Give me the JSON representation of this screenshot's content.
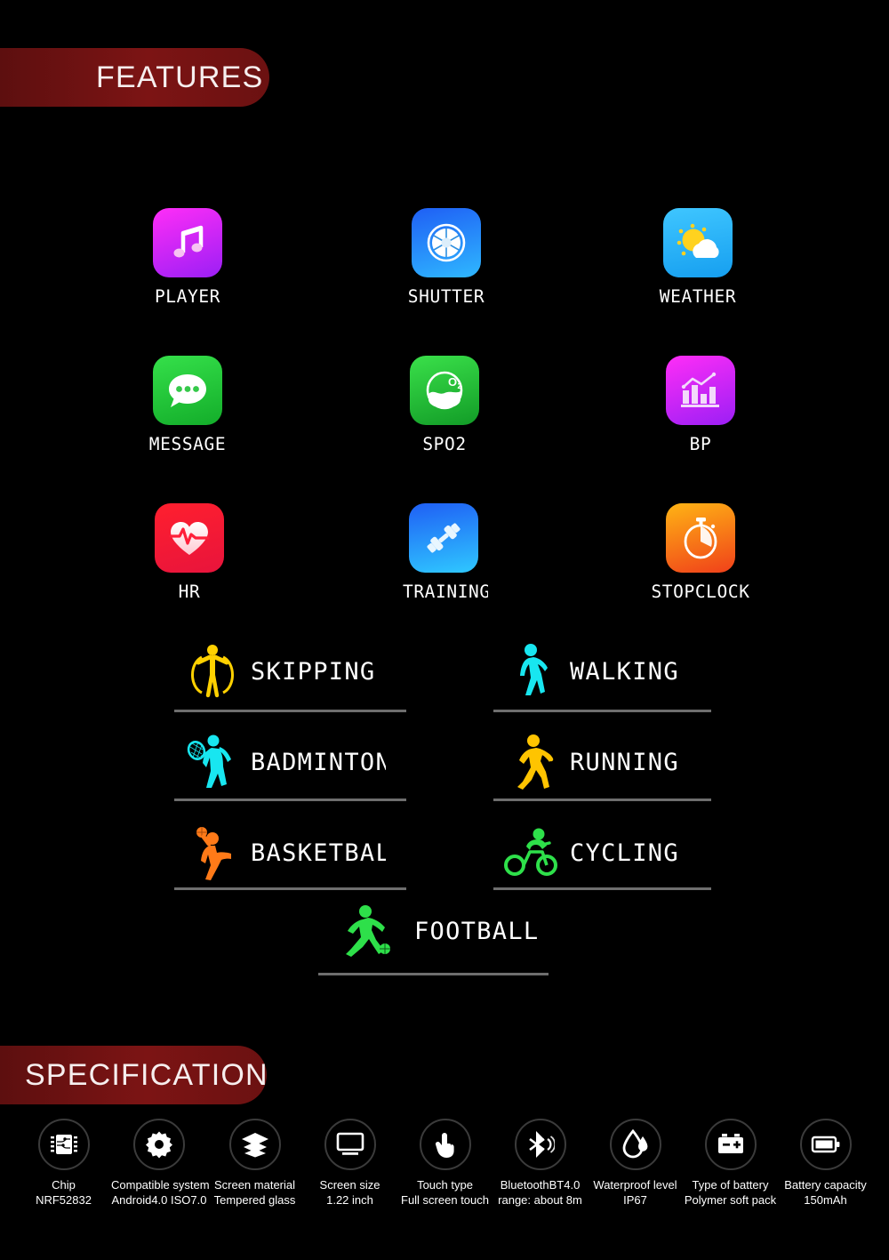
{
  "sections": {
    "features_banner": "FEATURES",
    "specification_banner": "SPECIFICATION"
  },
  "apps": [
    {
      "label": "PLAYER",
      "icon": "music-note-icon",
      "c1": "#ff2df7",
      "c2": "#9b1ff5"
    },
    {
      "label": "SHUTTER",
      "icon": "camera-shutter-icon",
      "c1": "#1f5ff5",
      "c2": "#2fb8ff"
    },
    {
      "label": "WEATHER",
      "icon": "sun-cloud-icon",
      "c1": "#2fb8ff",
      "c2": "#1f9ef5"
    },
    {
      "label": "MESSAGE",
      "icon": "speech-bubble-icon",
      "c1": "#2fe04a",
      "c2": "#13b52c"
    },
    {
      "label": "SPO2",
      "icon": "oxygen-drop-icon",
      "c1": "#35e04a",
      "c2": "#17a92a"
    },
    {
      "label": "BP",
      "icon": "bar-chart-icon",
      "c1": "#ff2df7",
      "c2": "#9b1ff5"
    },
    {
      "label": "HR",
      "icon": "heart-pulse-icon",
      "c1": "#ff1f2e",
      "c2": "#e8143c"
    },
    {
      "label": "TRAINING",
      "icon": "dumbbell-icon",
      "c1": "#1f5ff5",
      "c2": "#2fc8ff"
    },
    {
      "label": "STOPCLOCK",
      "icon": "stopwatch-icon",
      "c1": "#ffb414",
      "c2": "#f0401a"
    }
  ],
  "sports": [
    {
      "label": "SKIPPING",
      "icon": "skipping-rope-icon",
      "color": "#ffd100"
    },
    {
      "label": "WALKING",
      "icon": "walking-person-icon",
      "color": "#18e6f0"
    },
    {
      "label": "BADMINTON",
      "icon": "badminton-icon",
      "color": "#18e6f0"
    },
    {
      "label": "RUNNING",
      "icon": "running-person-icon",
      "color": "#ffc400"
    },
    {
      "label": "BASKETBALL",
      "icon": "basketball-icon",
      "color": "#ff7a18"
    },
    {
      "label": "CYCLING",
      "icon": "cycling-icon",
      "color": "#2ee04a"
    },
    {
      "label": "FOOTBALL",
      "icon": "football-icon",
      "color": "#2ee04a"
    }
  ],
  "specs": [
    {
      "title": "Chip",
      "value": "NRF52832",
      "icon": "chip-icon"
    },
    {
      "title": "Compatible system",
      "value": "Android4.0 ISO7.0",
      "icon": "gear-icon"
    },
    {
      "title": "Screen material",
      "value": "Tempered glass",
      "icon": "layers-icon"
    },
    {
      "title": "Screen size",
      "value": "1.22 inch",
      "icon": "monitor-icon"
    },
    {
      "title": "Touch type",
      "value": "Full screen touch",
      "icon": "hand-touch-icon"
    },
    {
      "title": "BluetoothBT4.0",
      "value": "range: about 8m",
      "icon": "bluetooth-icon"
    },
    {
      "title": "Waterproof level",
      "value": "IP67",
      "icon": "water-drop-icon"
    },
    {
      "title": "Type of battery",
      "value": "Polymer soft pack",
      "icon": "car-battery-icon"
    },
    {
      "title": "Battery capacity",
      "value": "150mAh",
      "icon": "battery-icon"
    }
  ],
  "colors": {
    "background": "#000000",
    "banner": "#7c1414",
    "text": "#ffffff",
    "divider": "#6e6e6e"
  }
}
